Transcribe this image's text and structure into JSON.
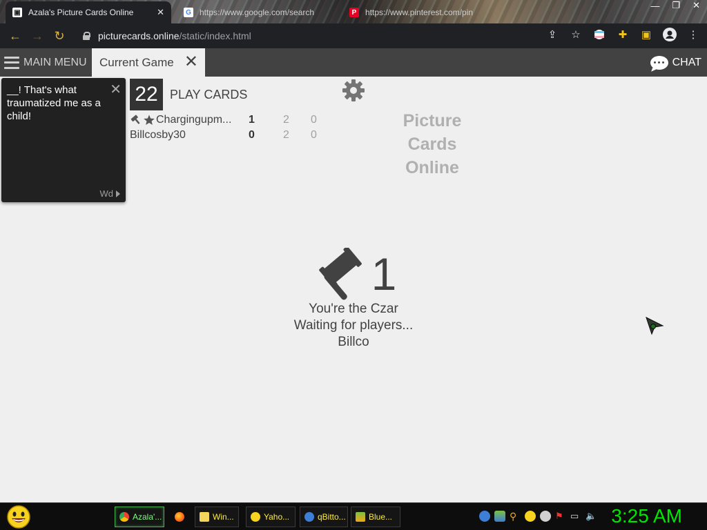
{
  "browser": {
    "tabs": [
      {
        "title": "Azala's Picture Cards Online"
      },
      {
        "title": "https://www.google.com/search"
      },
      {
        "title": "https://www.pinterest.com/pin"
      }
    ],
    "url_domain": "picturecards.online",
    "url_path": "/static/index.html"
  },
  "app": {
    "menu_label": "MAIN MENU",
    "game_tab_label": "Current Game",
    "chat_label": "CHAT"
  },
  "black_card": {
    "text": "__! That's what traumatized me as a child!",
    "footer": "Wd"
  },
  "play": {
    "count": "22",
    "label": "PLAY CARDS"
  },
  "scores": [
    {
      "name": "Chargingupm...",
      "points": "1",
      "col2": "2",
      "col3": "0"
    },
    {
      "name": "Billcosby30",
      "points": "0",
      "col2": "2",
      "col3": "0"
    }
  ],
  "brand": {
    "line1": "Picture",
    "line2": "Cards",
    "line3": "Online"
  },
  "status": {
    "round": "1",
    "line1": "You're the Czar",
    "line2": "Waiting for players...",
    "line3": "Billco"
  },
  "taskbar": {
    "tasks": [
      {
        "label": "Azala'..."
      },
      {
        "label": "Win..."
      },
      {
        "label": "Yaho..."
      },
      {
        "label": "qBitto..."
      },
      {
        "label": "Blue..."
      }
    ],
    "clock": "3:25 AM"
  },
  "colors": {
    "appbar": "#424242",
    "page_bg": "#efefef",
    "clock": "#00e600"
  }
}
